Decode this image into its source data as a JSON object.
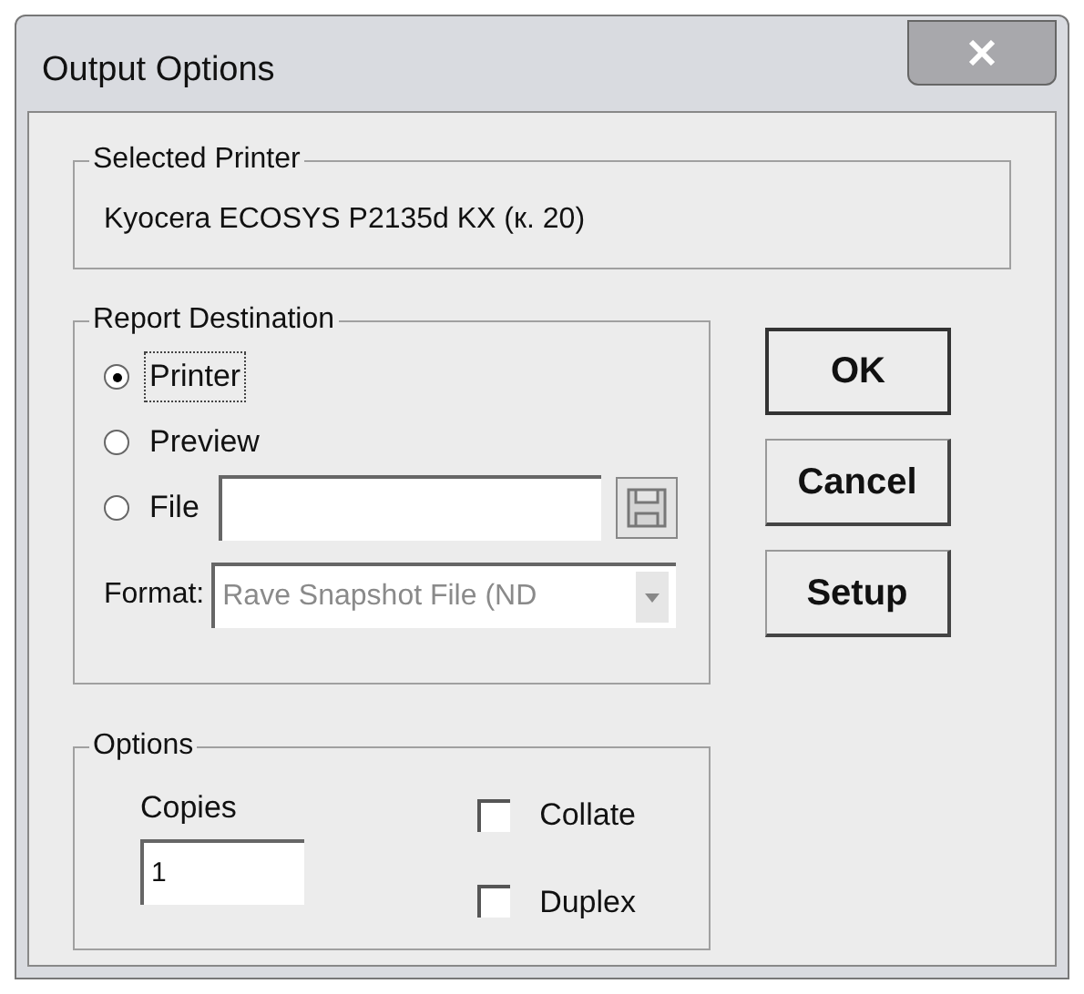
{
  "window": {
    "title": "Output Options"
  },
  "selected_printer": {
    "label": "Selected Printer",
    "value": "Kyocera ECOSYS P2135d KX (к. 20)"
  },
  "report_destination": {
    "label": "Report Destination",
    "options": [
      {
        "label": "Printer",
        "selected": true,
        "kind": "plain"
      },
      {
        "label": "Preview",
        "selected": false,
        "kind": "plain"
      },
      {
        "label": "File",
        "selected": false,
        "kind": "file"
      }
    ],
    "format": {
      "label": "Format:",
      "value": "Rave Snapshot File (ND",
      "disabled": true
    }
  },
  "options": {
    "label": "Options",
    "copies": {
      "label": "Copies",
      "value": "1"
    },
    "checkboxes": [
      {
        "label": "Collate",
        "checked": false
      },
      {
        "label": "Duplex",
        "checked": false
      }
    ]
  },
  "buttons": [
    {
      "label": "OK",
      "default": true
    },
    {
      "label": "Cancel",
      "default": false
    },
    {
      "label": "Setup",
      "default": false
    }
  ]
}
